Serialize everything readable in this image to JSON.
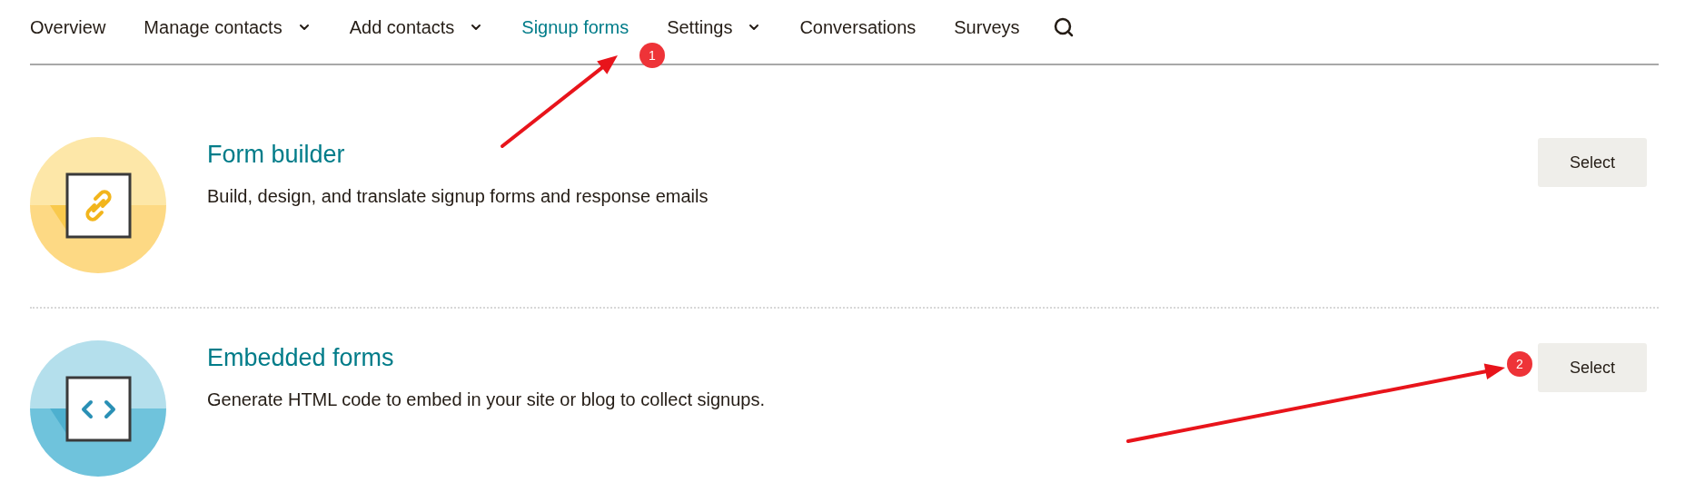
{
  "nav": {
    "items": [
      {
        "label": "Overview",
        "kind": "link",
        "selected": false
      },
      {
        "label": "Manage contacts",
        "kind": "dropdown",
        "selected": false
      },
      {
        "label": "Add contacts",
        "kind": "dropdown",
        "selected": false
      },
      {
        "label": "Signup forms",
        "kind": "link",
        "selected": true
      },
      {
        "label": "Settings",
        "kind": "dropdown",
        "selected": false
      },
      {
        "label": "Conversations",
        "kind": "link",
        "selected": false
      },
      {
        "label": "Surveys",
        "kind": "link",
        "selected": false
      }
    ]
  },
  "options": [
    {
      "title": "Form builder",
      "description": "Build, design, and translate signup forms and response emails",
      "kind": "link",
      "button": "Select"
    },
    {
      "title": "Embedded forms",
      "description": "Generate HTML code to embed in your site or blog to collect signups.",
      "kind": "code",
      "button": "Select"
    }
  ],
  "annotations": [
    {
      "label": "1"
    },
    {
      "label": "2"
    }
  ]
}
